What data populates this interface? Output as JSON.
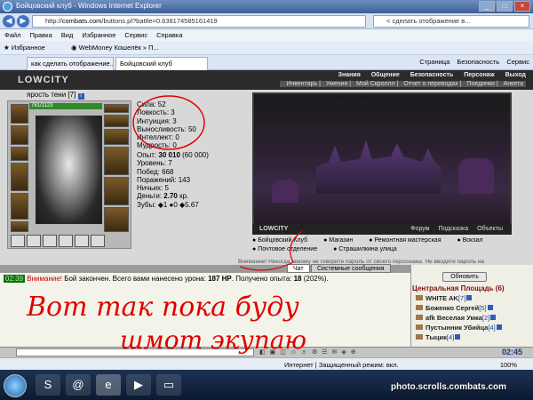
{
  "browser": {
    "window_title": "Бойцовский клуб - Windows Internet Explorer",
    "url_prefix": "http://",
    "url_domain": "combats.com",
    "url_rest": "/buttons.pl?battle=0.638174585161419",
    "search_text": "< сделать отображение в...",
    "menu": [
      "Файл",
      "Правка",
      "Вид",
      "Избранное",
      "Сервис",
      "Справка"
    ],
    "favorites_label": "Избранное",
    "fav_link": "WebMoney Кошелёк » П...",
    "tabs": [
      {
        "label": "как сделать отображение..."
      },
      {
        "label": "Бойцовский клуб"
      }
    ],
    "tools": [
      "Страница",
      "Безопасность",
      "Сервис"
    ],
    "status_text": "Интернет | Защищенный режим: вкл.",
    "zoom": "100%"
  },
  "game": {
    "logo": "LOWCITY",
    "top_menu": [
      "Знания",
      "Общение",
      "Безопасность",
      "Персонаж",
      "Выход"
    ],
    "sub_menu": [
      "Инвентарь",
      "Умения",
      "Мой Скроллл",
      "Отчет о переводах",
      "Поединки",
      "Анкета"
    ],
    "character": {
      "name": "ярость тени",
      "level": "[7]",
      "hp": "781/1123"
    },
    "stats": [
      "Сила: 52",
      "Ловкость: 3",
      "Интуиция: 3",
      "Выносливость: 50",
      "Интеллект: 0",
      "Мудрость: 0"
    ],
    "stats_extra": [
      {
        "label": "Опыт: ",
        "value": "30 010",
        "rest": " (60 000)"
      },
      {
        "label": "Уровень: 7",
        "value": "",
        "rest": ""
      },
      {
        "label": "Побед: 668",
        "value": "",
        "rest": ""
      },
      {
        "label": "Поражений: 143",
        "value": "",
        "rest": ""
      },
      {
        "label": "Ничьих: 5",
        "value": "",
        "rest": ""
      },
      {
        "label": "Деньги: ",
        "value": "2.70",
        "rest": " кр."
      },
      {
        "label": "Зубы: ◆1 ●0 ◆5.67",
        "value": "",
        "rest": ""
      }
    ],
    "scene": {
      "logo": "LOWCITY",
      "links": [
        "Форум",
        "Подсказка",
        "Объекты"
      ]
    },
    "locations": [
      "Бойцовский Клуб",
      "Магазин",
      "Ремонтная мастерская",
      "Вокзал",
      "Почтовое отделение",
      "Страшилкина улица"
    ],
    "notice": "Внимание! Никогда никому не говорите пароль от своего персонажа. Не вводите пароль на"
  },
  "chat": {
    "tabs": [
      "Чат",
      "Системные сообщения"
    ],
    "time": "02:39",
    "warn_label": "Внимание!",
    "message": " Бой закончен. Всего вами нанесено урона: ",
    "damage": "187 HP",
    "message2": ". Получено опыта: ",
    "exp": "18",
    "exp_pct": " (202%).",
    "refresh_label": "Обновить",
    "location": "Центральная Площадь (6)",
    "users": [
      {
        "name": "WHITE AK",
        "level": "[7]"
      },
      {
        "name": "Боженко Сергей",
        "level": "[5]"
      },
      {
        "name": "afk Веселая Умка",
        "level": "[2]"
      },
      {
        "name": "Пустынник Убийца",
        "level": "[4]"
      },
      {
        "name": "Тыцик",
        "level": "[4]"
      }
    ],
    "clock": "02:45"
  },
  "watermark": "photo.scrolls.combats.com",
  "handwriting": {
    "line1": "Вот так пока буду",
    "line2": "шмот экупаю"
  },
  "colors": {
    "accent": "#c00000",
    "scrawl": "#e00000"
  }
}
